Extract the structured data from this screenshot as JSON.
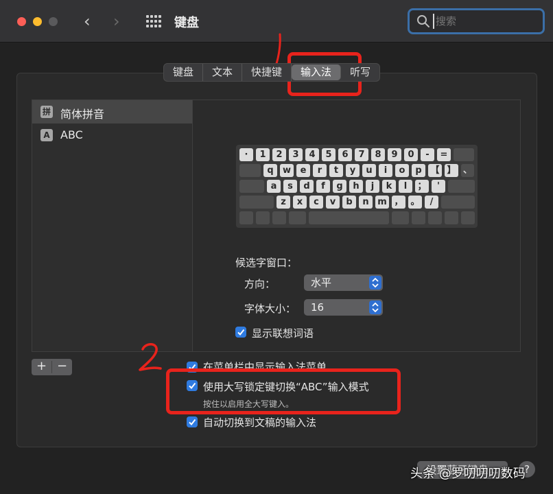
{
  "window": {
    "title": "键盘",
    "back_glyph": "‹",
    "forward_glyph": "›"
  },
  "search": {
    "placeholder": "搜索"
  },
  "tabs": [
    {
      "label": "键盘"
    },
    {
      "label": "文本"
    },
    {
      "label": "快捷键"
    },
    {
      "label": "输入法",
      "active": true
    },
    {
      "label": "听写"
    }
  ],
  "input_sources": [
    {
      "badge": "拼",
      "label": "简体拼音",
      "selected": true
    },
    {
      "badge": "A",
      "label": "ABC",
      "selected": false
    }
  ],
  "keyboard": {
    "rows": [
      [
        "·",
        "1",
        "2",
        "3",
        "4",
        "5",
        "6",
        "7",
        "8",
        "9",
        "0",
        "-",
        "="
      ],
      [
        "q",
        "w",
        "e",
        "r",
        "t",
        "y",
        "u",
        "i",
        "o",
        "p",
        "【",
        "】",
        "、"
      ],
      [
        "a",
        "s",
        "d",
        "f",
        "g",
        "h",
        "j",
        "k",
        "l",
        "；",
        "'"
      ],
      [
        "z",
        "x",
        "c",
        "v",
        "b",
        "n",
        "m",
        "，",
        "。",
        "/"
      ]
    ]
  },
  "candidate_window": {
    "heading": "候选字窗口：",
    "direction_label": "方向：",
    "direction_value": "水平",
    "font_size_label": "字体大小：",
    "font_size_value": "16",
    "show_predictions_label": "显示联想词语",
    "show_predictions_checked": true
  },
  "list_buttons": {
    "add": "+",
    "remove": "−"
  },
  "options": {
    "show_in_menu_bar": {
      "label": "在菜单栏中显示输入法菜单",
      "checked": true
    },
    "caps_lock_switch": {
      "label": "使用大写锁定键切换“ABC”输入模式",
      "sub": "按住以启用全大写键入。",
      "checked": true
    },
    "auto_switch": {
      "label": "自动切换到文稿的输入法",
      "checked": true
    }
  },
  "footer": {
    "setup_button": "设置蓝牙键盘…",
    "help_button": "?"
  },
  "watermark": "头条 @罗叨叨叨数码",
  "annotations": {
    "mark_1": "1",
    "mark_2": "2",
    "color": "#e8231c"
  },
  "colors": {
    "accent": "#2f7be0",
    "search_focus": "#3b6fa8"
  }
}
